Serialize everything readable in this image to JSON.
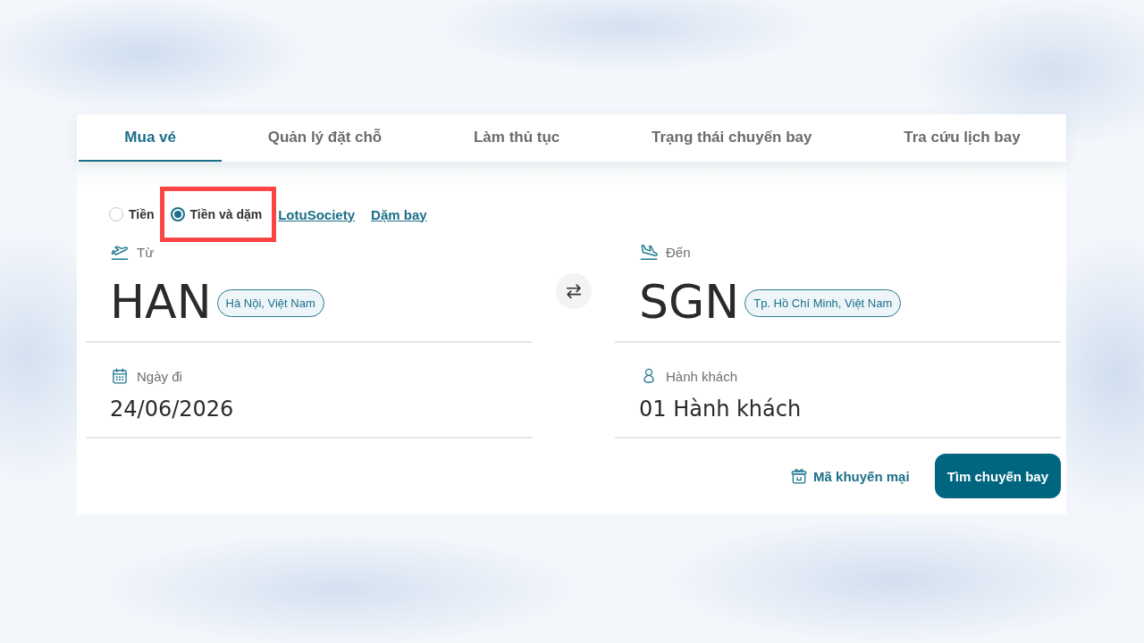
{
  "tabs": [
    {
      "label": "Mua vé",
      "selected": true
    },
    {
      "label": "Quản lý đặt chỗ",
      "selected": false
    },
    {
      "label": "Làm thủ tục",
      "selected": false
    },
    {
      "label": "Trạng thái chuyến bay",
      "selected": false
    },
    {
      "label": "Tra cứu lịch bay",
      "selected": false
    }
  ],
  "payment_options": [
    {
      "label": "Tiền",
      "selected": false,
      "highlighted": false
    },
    {
      "label": "Tiền và dặm",
      "selected": true,
      "highlighted": true
    }
  ],
  "links": [
    "LotuSociety",
    "Dặm bay"
  ],
  "route": [
    {
      "kind": "departure",
      "label": "Từ",
      "code": "HAN",
      "city": "Hà Nội, Việt Nam"
    },
    {
      "kind": "arrival",
      "label": "Đến",
      "code": "SGN",
      "city": "Tp. Hồ Chí Minh, Việt Nam"
    }
  ],
  "details": [
    {
      "kind": "date",
      "label": "Ngày đi",
      "value": "24/06/2026"
    },
    {
      "kind": "passengers",
      "label": "Hành khách",
      "value": "01 Hành khách"
    }
  ],
  "promo_link": "Mã khuyến mại",
  "search_button": "Tìm chuyến bay"
}
